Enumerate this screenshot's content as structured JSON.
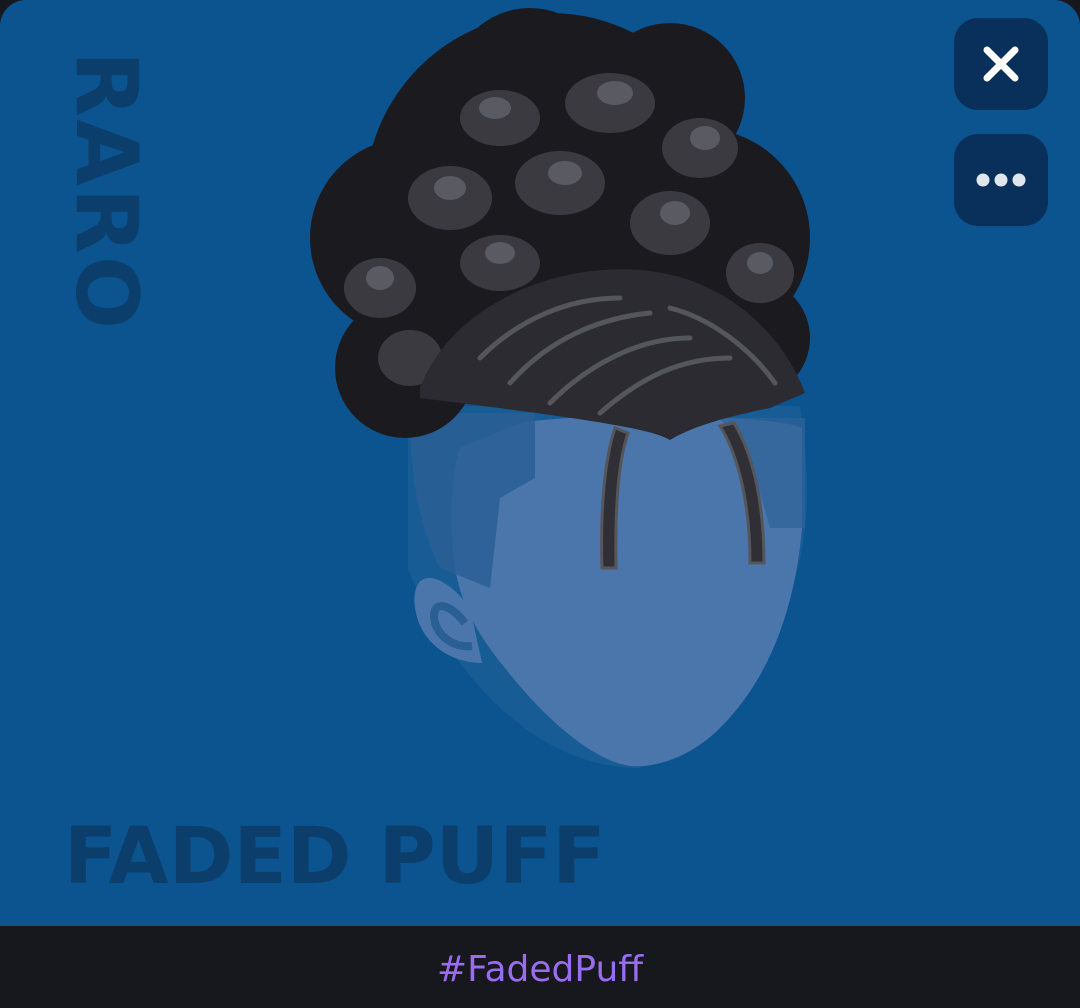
{
  "card": {
    "rarity": "RARO",
    "item_name": "FADED PUFF",
    "close_icon": "close-icon",
    "more_icon": "more-horizontal-icon"
  },
  "footer": {
    "hashtag": "#FadedPuff"
  },
  "colors": {
    "card_background": "#0b5490",
    "watermark_text": "#0c3e6b",
    "button_background": "#09305a",
    "hashtag": "#9a6cf0",
    "bottom_bar": "#17171e"
  }
}
